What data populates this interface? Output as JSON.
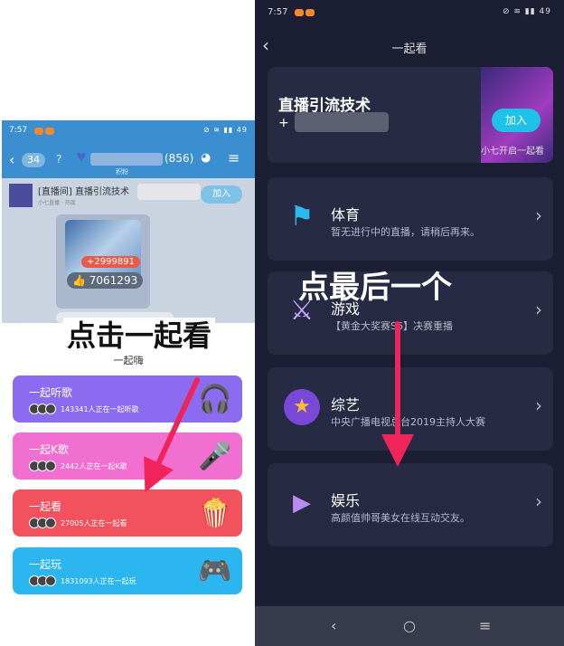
{
  "left": {
    "status": {
      "time": "7:57",
      "icons": "⊘ ≋ ▮▮ 49"
    },
    "header": {
      "back": "‹",
      "count": "34",
      "number": "(856)",
      "sub": "积粉"
    },
    "room": {
      "title": "[直播间] 直播引流技术",
      "sub": "小七直播 · 热度",
      "join": "加入",
      "red_count": "+2999891",
      "likes": "7061293"
    },
    "annotation": "点击一起看",
    "sheet": {
      "title": "一起嗨",
      "items": [
        {
          "label": "一起听歌",
          "count": "143341人正在一起听歌",
          "icon": "headphones-icon"
        },
        {
          "label": "一起K歌",
          "count": "2442人正在一起K歌",
          "icon": "microphone-icon"
        },
        {
          "label": "一起看",
          "count": "27005人正在一起看",
          "icon": "popcorn-icon"
        },
        {
          "label": "一起玩",
          "count": "1831093人正在一起玩",
          "icon": "gamepad-icon"
        }
      ]
    }
  },
  "right": {
    "status": {
      "time": "7:57",
      "icons": "⊘ ≋ ▮▮ 49"
    },
    "title": "一起看",
    "banner": {
      "title": "直播引流技术",
      "prefix": "+",
      "join": "加入",
      "note": "小七开启一起看"
    },
    "annotation": "点最后一个",
    "categories": [
      {
        "name": "体育",
        "desc": "暂无进行中的直播，请稍后再来。",
        "icon": "sports-icon"
      },
      {
        "name": "游戏",
        "desc": "【黄金大奖赛S6】决赛重播",
        "icon": "game-swords-icon"
      },
      {
        "name": "综艺",
        "desc": "中央广播电视总台2019主持人大赛",
        "icon": "star-icon"
      },
      {
        "name": "娱乐",
        "desc": "高颜值帅哥美女在线互动交友。",
        "icon": "camera-icon"
      }
    ],
    "nav": {
      "back": "‹",
      "home": "○",
      "menu": "≡"
    }
  },
  "colors": {
    "arrow": "#f0245a",
    "join": "#1ec2e8",
    "listen": "#8b6cf0",
    "ksong": "#f06fd0",
    "watch": "#f2525e",
    "play": "#2cb6f0"
  }
}
